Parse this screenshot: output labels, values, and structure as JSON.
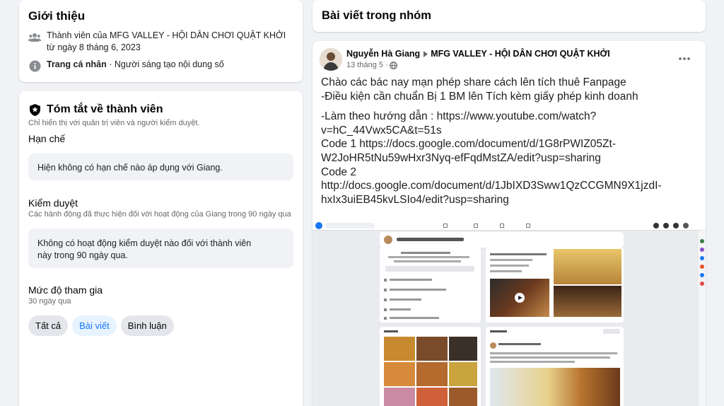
{
  "intro": {
    "title": "Giới thiệu",
    "member_prefix": "Thành viên của ",
    "group_name": "MFG VALLEY - HỘI DÂN CHƠI QUẬT KHỞI",
    "member_suffix": " từ ngày 8 tháng 6, 2023",
    "profile_label": "Trang cá nhân",
    "profile_suffix": " · Người sáng tạo nội dung số"
  },
  "summary": {
    "title": "Tóm tắt về thành viên",
    "visibility_note": "Chỉ hiển thị với quản trị viên và người kiểm duyệt.",
    "restrictions_title": "Hạn chế",
    "restrictions_text": "Hiện không có hạn chế nào áp dụng với Giang.",
    "moderation_title": "Kiểm duyệt",
    "moderation_sub": "Các hành động đã thực hiện đối với hoạt động của Giang trong 90 ngày qua",
    "moderation_text": "Không có hoạt động kiểm duyệt nào đối với thành viên này trong 90 ngày qua.",
    "engagement_title": "Mức độ tham gia",
    "engagement_sub": "30 ngày qua",
    "tabs": [
      "Tất cả",
      "Bài viết",
      "Bình luận"
    ],
    "active_tab": 1
  },
  "group_posts": {
    "title": "Bài viết trong nhóm"
  },
  "post": {
    "author": "Nguyễn Hà Giang",
    "group": "MFG VALLEY - HỘI DÂN CHƠI QUẬT KHỞI",
    "date": "13 tháng 5 · ",
    "lines": [
      "Chào các bác nay mạn phép share cách lên tích thuê Fanpage",
      "-Điều kiện cần chuẩn Bị 1 BM lên Tích kèm giấy phép kinh doanh",
      "-Làm theo hướng dẫn : https://www.youtube.com/watch?",
      "v=hC_44Vwx5CA&t=51s",
      "Code 1 https://docs.google.com/document/d/1G8rPWIZ05Zt-",
      "W2JoHR5tNu59wHxr3Nyq-efFqdMstZA/edit?usp=sharing",
      "Code 2",
      "http://docs.google.com/document/d/1JbIXD3Sww1QzCCGMN9X1jzdI-",
      "hxIx3uiEB45kvLSIo4/edit?usp=sharing"
    ]
  },
  "colors": {
    "accent": "#1877f2",
    "background": "#f0f2f5",
    "muted": "#65676b"
  },
  "icons": [
    "members-icon",
    "info-icon",
    "shield-icon",
    "caret-right-icon",
    "globe-icon",
    "more-icon"
  ]
}
